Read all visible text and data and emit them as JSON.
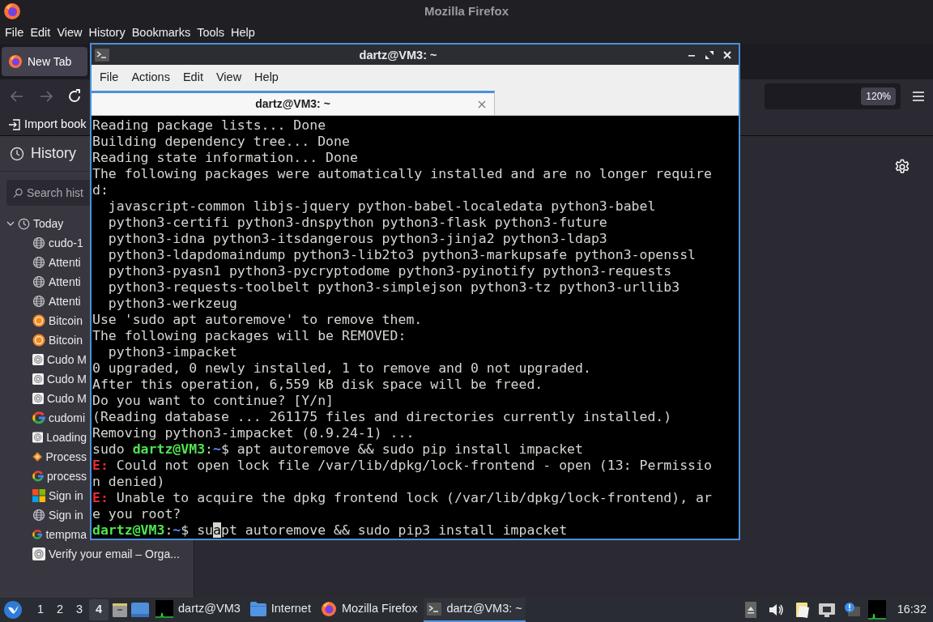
{
  "firefox": {
    "title": "Mozilla Firefox",
    "menu": [
      "File",
      "Edit",
      "View",
      "History",
      "Bookmarks",
      "Tools",
      "Help"
    ],
    "tabs": [
      {
        "label": "New Tab",
        "selected": true
      }
    ],
    "zoom": "120%",
    "bookmarks_toolbar": [
      {
        "label": "Import book"
      }
    ],
    "sidebar": {
      "title": "History",
      "search_placeholder": "Search hist",
      "groups": [
        {
          "label": "Today",
          "expanded": true,
          "children": [
            {
              "label": "cudo-1",
              "kind": "globe"
            },
            {
              "label": "Attenti",
              "kind": "globe"
            },
            {
              "label": "Attenti",
              "kind": "globe"
            },
            {
              "label": "Attenti",
              "kind": "globe"
            },
            {
              "label": "Bitcoin",
              "kind": "coin"
            },
            {
              "label": "Bitcoin",
              "kind": "coin"
            },
            {
              "label": "Cudo M",
              "kind": "ring"
            },
            {
              "label": "Cudo M",
              "kind": "ring"
            },
            {
              "label": "Cudo M",
              "kind": "ring"
            },
            {
              "label": "cudomi",
              "kind": "g"
            },
            {
              "label": "Loading",
              "kind": "ring"
            },
            {
              "label": "Process",
              "kind": "diamond"
            },
            {
              "label": "process",
              "kind": "g"
            },
            {
              "label": "Sign in",
              "kind": "squares"
            },
            {
              "label": "Sign in",
              "kind": "globe"
            },
            {
              "label": "tempma",
              "kind": "g"
            },
            {
              "label": "Verify your email – Orga...",
              "kind": "ring"
            }
          ]
        }
      ]
    }
  },
  "terminal": {
    "title": "dartz@VM3: ~",
    "menu": [
      "File",
      "Actions",
      "Edit",
      "View",
      "Help"
    ],
    "tabs": [
      {
        "label": "dartz@VM3: ~",
        "selected": true
      }
    ],
    "lines": [
      {
        "text": "Reading package lists... Done"
      },
      {
        "text": "Building dependency tree... Done"
      },
      {
        "text": "Reading state information... Done"
      },
      {
        "text": "The following packages were automatically installed and are no longer require"
      },
      {
        "text": "d:"
      },
      {
        "text": "  javascript-common libjs-jquery python-babel-localedata python3-babel"
      },
      {
        "text": "  python3-certifi python3-dnspython python3-flask python3-future"
      },
      {
        "text": "  python3-idna python3-itsdangerous python3-jinja2 python3-ldap3"
      },
      {
        "text": "  python3-ldapdomaindump python3-lib2to3 python3-markupsafe python3-openssl"
      },
      {
        "text": "  python3-pyasn1 python3-pycryptodome python3-pyinotify python3-requests"
      },
      {
        "text": "  python3-requests-toolbelt python3-simplejson python3-tz python3-urllib3"
      },
      {
        "text": "  python3-werkzeug"
      },
      {
        "text": "Use 'sudo apt autoremove' to remove them."
      },
      {
        "text": "The following packages will be REMOVED:"
      },
      {
        "text": "  python3-impacket"
      },
      {
        "text": "0 upgraded, 0 newly installed, 1 to remove and 0 not upgraded."
      },
      {
        "text": "After this operation, 6,559 kB disk space will be freed."
      },
      {
        "text": "Do you want to continue? [Y/n]"
      },
      {
        "text": "(Reading database ... 261175 files and directories currently installed.)"
      },
      {
        "text": "Removing python3-impacket (0.9.24-1) ..."
      },
      {
        "segments": [
          {
            "text": "sudo ",
            "kind": "plain"
          },
          {
            "text": "dartz@VM3",
            "kind": "user"
          },
          {
            "text": ":",
            "kind": "plain"
          },
          {
            "text": "~",
            "kind": "path"
          },
          {
            "text": "$ apt autoremove && sudo pip install impacket",
            "kind": "plain"
          }
        ]
      },
      {
        "segments": [
          {
            "text": "E:",
            "kind": "error"
          },
          {
            "text": " Could not open lock file /var/lib/dpkg/lock-frontend - open (13: Permissio",
            "kind": "plain"
          }
        ]
      },
      {
        "text": "n denied)"
      },
      {
        "segments": [
          {
            "text": "E:",
            "kind": "error"
          },
          {
            "text": " Unable to acquire the dpkg frontend lock (/var/lib/dpkg/lock-frontend), ar",
            "kind": "plain"
          }
        ]
      },
      {
        "text": "e you root?"
      },
      {
        "segments": [
          {
            "text": "dartz@VM3",
            "kind": "user"
          },
          {
            "text": ":",
            "kind": "plain"
          },
          {
            "text": "~",
            "kind": "path"
          },
          {
            "text": "$ su",
            "kind": "plain"
          },
          {
            "text": "a",
            "kind": "cursor"
          },
          {
            "text": "pt autoremove && sudo pip3 install impacket",
            "kind": "plain"
          }
        ]
      }
    ]
  },
  "taskbar": {
    "workspaces": [
      {
        "label": "1",
        "selected": false
      },
      {
        "label": "2",
        "selected": false
      },
      {
        "label": "3",
        "selected": false
      },
      {
        "label": "4",
        "selected": true
      }
    ],
    "tasks": [
      {
        "label": "dartz@VM3",
        "kind": "graph",
        "selected": false
      },
      {
        "label": "Internet",
        "kind": "folder",
        "selected": false
      },
      {
        "label": "Mozilla Firefox",
        "kind": "browser",
        "selected": false
      },
      {
        "label": "dartz@VM3: ~",
        "kind": "terminal",
        "selected": true
      }
    ],
    "clock": "16:32"
  }
}
